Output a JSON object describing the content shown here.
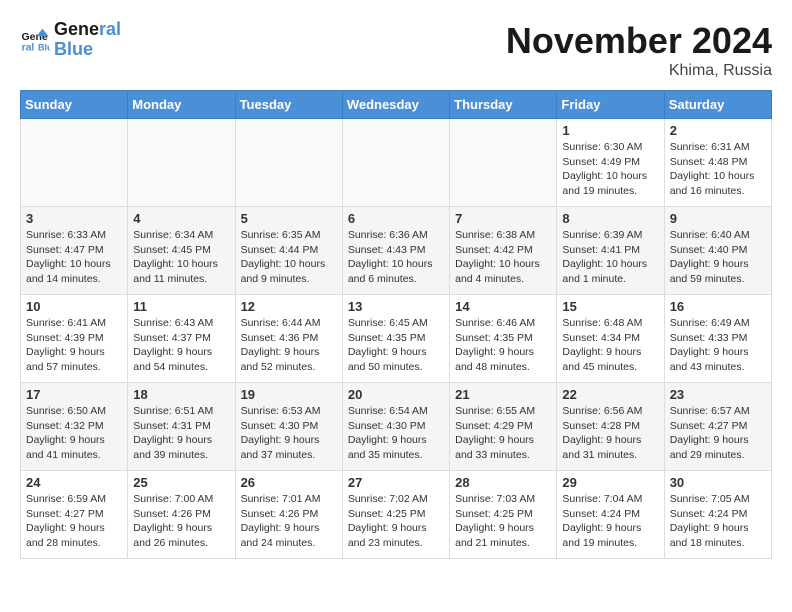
{
  "header": {
    "logo_line1": "General",
    "logo_line2": "Blue",
    "month": "November 2024",
    "location": "Khima, Russia"
  },
  "weekdays": [
    "Sunday",
    "Monday",
    "Tuesday",
    "Wednesday",
    "Thursday",
    "Friday",
    "Saturday"
  ],
  "weeks": [
    [
      {
        "day": "",
        "content": ""
      },
      {
        "day": "",
        "content": ""
      },
      {
        "day": "",
        "content": ""
      },
      {
        "day": "",
        "content": ""
      },
      {
        "day": "",
        "content": ""
      },
      {
        "day": "1",
        "content": "Sunrise: 6:30 AM\nSunset: 4:49 PM\nDaylight: 10 hours and 19 minutes."
      },
      {
        "day": "2",
        "content": "Sunrise: 6:31 AM\nSunset: 4:48 PM\nDaylight: 10 hours and 16 minutes."
      }
    ],
    [
      {
        "day": "3",
        "content": "Sunrise: 6:33 AM\nSunset: 4:47 PM\nDaylight: 10 hours and 14 minutes."
      },
      {
        "day": "4",
        "content": "Sunrise: 6:34 AM\nSunset: 4:45 PM\nDaylight: 10 hours and 11 minutes."
      },
      {
        "day": "5",
        "content": "Sunrise: 6:35 AM\nSunset: 4:44 PM\nDaylight: 10 hours and 9 minutes."
      },
      {
        "day": "6",
        "content": "Sunrise: 6:36 AM\nSunset: 4:43 PM\nDaylight: 10 hours and 6 minutes."
      },
      {
        "day": "7",
        "content": "Sunrise: 6:38 AM\nSunset: 4:42 PM\nDaylight: 10 hours and 4 minutes."
      },
      {
        "day": "8",
        "content": "Sunrise: 6:39 AM\nSunset: 4:41 PM\nDaylight: 10 hours and 1 minute."
      },
      {
        "day": "9",
        "content": "Sunrise: 6:40 AM\nSunset: 4:40 PM\nDaylight: 9 hours and 59 minutes."
      }
    ],
    [
      {
        "day": "10",
        "content": "Sunrise: 6:41 AM\nSunset: 4:39 PM\nDaylight: 9 hours and 57 minutes."
      },
      {
        "day": "11",
        "content": "Sunrise: 6:43 AM\nSunset: 4:37 PM\nDaylight: 9 hours and 54 minutes."
      },
      {
        "day": "12",
        "content": "Sunrise: 6:44 AM\nSunset: 4:36 PM\nDaylight: 9 hours and 52 minutes."
      },
      {
        "day": "13",
        "content": "Sunrise: 6:45 AM\nSunset: 4:35 PM\nDaylight: 9 hours and 50 minutes."
      },
      {
        "day": "14",
        "content": "Sunrise: 6:46 AM\nSunset: 4:35 PM\nDaylight: 9 hours and 48 minutes."
      },
      {
        "day": "15",
        "content": "Sunrise: 6:48 AM\nSunset: 4:34 PM\nDaylight: 9 hours and 45 minutes."
      },
      {
        "day": "16",
        "content": "Sunrise: 6:49 AM\nSunset: 4:33 PM\nDaylight: 9 hours and 43 minutes."
      }
    ],
    [
      {
        "day": "17",
        "content": "Sunrise: 6:50 AM\nSunset: 4:32 PM\nDaylight: 9 hours and 41 minutes."
      },
      {
        "day": "18",
        "content": "Sunrise: 6:51 AM\nSunset: 4:31 PM\nDaylight: 9 hours and 39 minutes."
      },
      {
        "day": "19",
        "content": "Sunrise: 6:53 AM\nSunset: 4:30 PM\nDaylight: 9 hours and 37 minutes."
      },
      {
        "day": "20",
        "content": "Sunrise: 6:54 AM\nSunset: 4:30 PM\nDaylight: 9 hours and 35 minutes."
      },
      {
        "day": "21",
        "content": "Sunrise: 6:55 AM\nSunset: 4:29 PM\nDaylight: 9 hours and 33 minutes."
      },
      {
        "day": "22",
        "content": "Sunrise: 6:56 AM\nSunset: 4:28 PM\nDaylight: 9 hours and 31 minutes."
      },
      {
        "day": "23",
        "content": "Sunrise: 6:57 AM\nSunset: 4:27 PM\nDaylight: 9 hours and 29 minutes."
      }
    ],
    [
      {
        "day": "24",
        "content": "Sunrise: 6:59 AM\nSunset: 4:27 PM\nDaylight: 9 hours and 28 minutes."
      },
      {
        "day": "25",
        "content": "Sunrise: 7:00 AM\nSunset: 4:26 PM\nDaylight: 9 hours and 26 minutes."
      },
      {
        "day": "26",
        "content": "Sunrise: 7:01 AM\nSunset: 4:26 PM\nDaylight: 9 hours and 24 minutes."
      },
      {
        "day": "27",
        "content": "Sunrise: 7:02 AM\nSunset: 4:25 PM\nDaylight: 9 hours and 23 minutes."
      },
      {
        "day": "28",
        "content": "Sunrise: 7:03 AM\nSunset: 4:25 PM\nDaylight: 9 hours and 21 minutes."
      },
      {
        "day": "29",
        "content": "Sunrise: 7:04 AM\nSunset: 4:24 PM\nDaylight: 9 hours and 19 minutes."
      },
      {
        "day": "30",
        "content": "Sunrise: 7:05 AM\nSunset: 4:24 PM\nDaylight: 9 hours and 18 minutes."
      }
    ]
  ]
}
